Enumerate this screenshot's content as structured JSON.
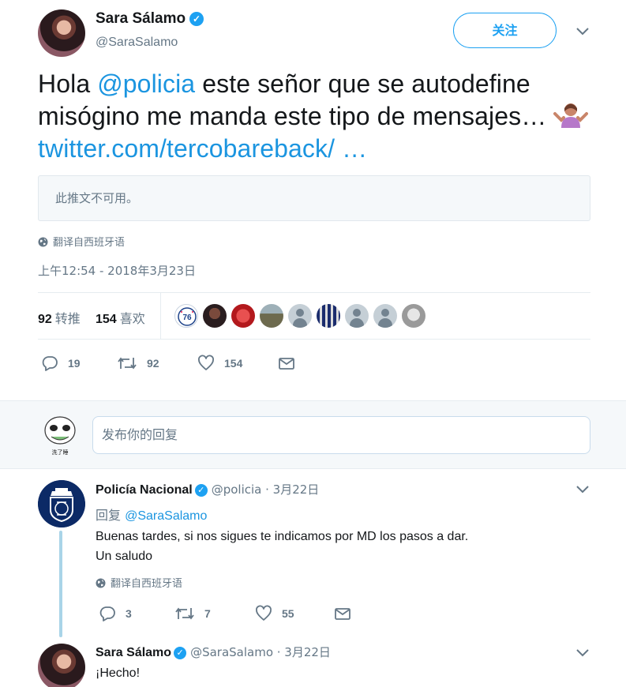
{
  "main_tweet": {
    "author_name": "Sara Sálamo",
    "author_handle": "@SaraSalamo",
    "follow_label": "关注",
    "text_prefix": "Hola ",
    "mention": "@policia",
    "text_middle": " este señor que se autodefine misógino me manda este tipo de mensajes… ",
    "emoji_icon": "person-shrugging-emoji",
    "link": "twitter.com/tercobareback/ …",
    "unavailable_notice": "此推文不可用。",
    "translate_label": "翻译自西班牙语",
    "timestamp": "上午12:54 - 2018年3月23日",
    "retweets_count": "92",
    "retweets_label": "转推",
    "likes_count": "154",
    "likes_label": "喜欢",
    "liker_avatars": [
      "76ers-logo",
      "dark-photo",
      "red-photo",
      "outdoor-photo",
      "default-avatar",
      "striped-shirt-photo",
      "default-avatar",
      "default-avatar",
      "grey-photo"
    ],
    "actions": {
      "reply_count": "19",
      "retweet_count": "92",
      "like_count": "154"
    }
  },
  "composer": {
    "placeholder": "发布你的回复",
    "avatar_caption": "洗了睡"
  },
  "replies": [
    {
      "author_name": "Policía Nacional",
      "meta": "@policia · 3月22日",
      "reply_to_label": "回复",
      "reply_to_handle": "@SaraSalamo",
      "text_line1": "Buenas tardes, si nos sigues te indicamos por MD los pasos a dar.",
      "text_line2": "Un saludo",
      "translate_label": "翻译自西班牙语",
      "reply_count": "3",
      "retweet_count": "7",
      "like_count": "55"
    },
    {
      "author_name": "Sara Sálamo",
      "meta": "@SaraSalamo · 3月22日",
      "text": "¡Hecho!"
    }
  ],
  "colors": {
    "accent": "#1da1f2",
    "link": "#1b95e0",
    "muted": "#657786",
    "thread_line": "#a9d4e8",
    "composer_bg": "#f5f8fa"
  }
}
